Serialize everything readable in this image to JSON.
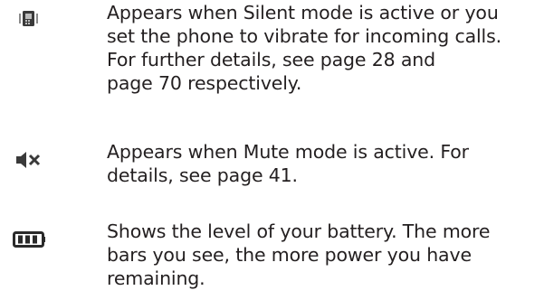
{
  "entries": [
    {
      "icon": "silent-vibrate-icon",
      "lines": [
        "Appears when Silent mode is active or you",
        "set the phone to vibrate for incoming calls.",
        "For further details, see page 28 and",
        "page 70 respectively."
      ]
    },
    {
      "icon": "mute-icon",
      "lines": [
        "Appears when Mute mode is active. For",
        "details, see page 41."
      ]
    },
    {
      "icon": "battery-level-icon",
      "lines": [
        "Shows the level of your battery. The more",
        "bars you see, the more power you have",
        "remaining."
      ]
    }
  ]
}
